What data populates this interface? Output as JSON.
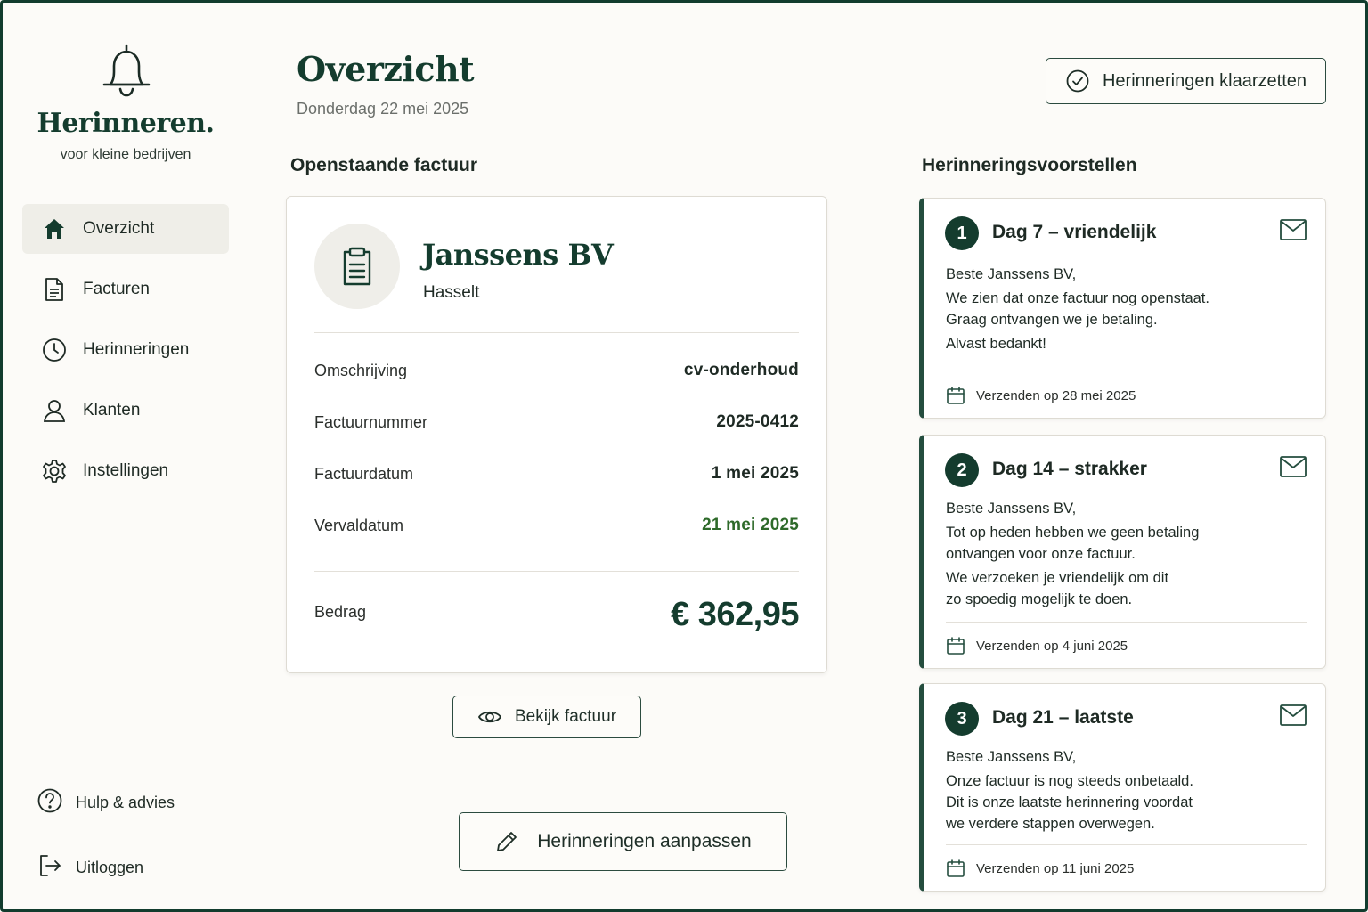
{
  "brand": {
    "title": "Herinneren.",
    "subtitle": "voor kleine bedrijven"
  },
  "nav": [
    {
      "label": "Overzicht",
      "icon": "home-icon",
      "active": true
    },
    {
      "label": "Facturen",
      "icon": "document-icon"
    },
    {
      "label": "Herinneringen",
      "icon": "clock-icon"
    },
    {
      "label": "Klanten",
      "icon": "user-icon"
    },
    {
      "label": "Instellingen",
      "icon": "gear-icon"
    }
  ],
  "nav_bottom": [
    {
      "label": "Hulp & advies",
      "icon": "help-icon"
    },
    {
      "label": "Uitloggen",
      "icon": "logout-icon"
    }
  ],
  "header": {
    "title": "Overzicht",
    "date": "Donderdag 22 mei 2025",
    "clear_button": "Herinneringen klaarzetten"
  },
  "invoice": {
    "section_title": "Openstaande factuur",
    "company": "Janssens BV",
    "city": "Hasselt",
    "rows": [
      {
        "label": "Omschrijving",
        "value": "cv-onderhoud"
      },
      {
        "label": "Factuurnummer",
        "value": "2025-0412"
      },
      {
        "label": "Factuurdatum",
        "value": "1 mei 2025"
      },
      {
        "label": "Vervaldatum",
        "value": "21 mei 2025"
      }
    ],
    "amount_label": "Bedrag",
    "amount": "€ 362,95",
    "view_button": "Bekijk factuur",
    "edit_button": "Herinneringen aanpassen"
  },
  "reminders": {
    "section_title": "Herinneringsvoorstellen",
    "items": [
      {
        "number": "1",
        "title": "Dag 7 – vriendelijk",
        "greeting": "Beste Janssens BV,",
        "lines": [
          "We zien dat onze factuur nog openstaat.\nGraag ontvangen we je betaling.",
          "Alvast bedankt!"
        ],
        "send": "Verzenden op 28 mei 2025"
      },
      {
        "number": "2",
        "title": "Dag 14 – strakker",
        "greeting": "Beste Janssens BV,",
        "lines": [
          "Tot op heden hebben we geen betaling\nontvangen voor onze factuur.",
          "We verzoeken je vriendelijk om dit\nzo spoedig mogelijk te doen."
        ],
        "send": "Verzenden op 4 juni 2025"
      },
      {
        "number": "3",
        "title": "Dag 21 – laatste",
        "greeting": "Beste Janssens BV,",
        "lines": [
          "Onze factuur is nog steeds onbetaald.\nDit is onze laatste herinnering voordat\nwe verdere stappen overwegen."
        ],
        "send": "Verzenden op 11 juni 2025"
      }
    ]
  },
  "colors": {
    "brand": "#143c2e",
    "accent": "#244d3e",
    "due": "#2e6a2a",
    "active_nav": "#efeee8"
  }
}
